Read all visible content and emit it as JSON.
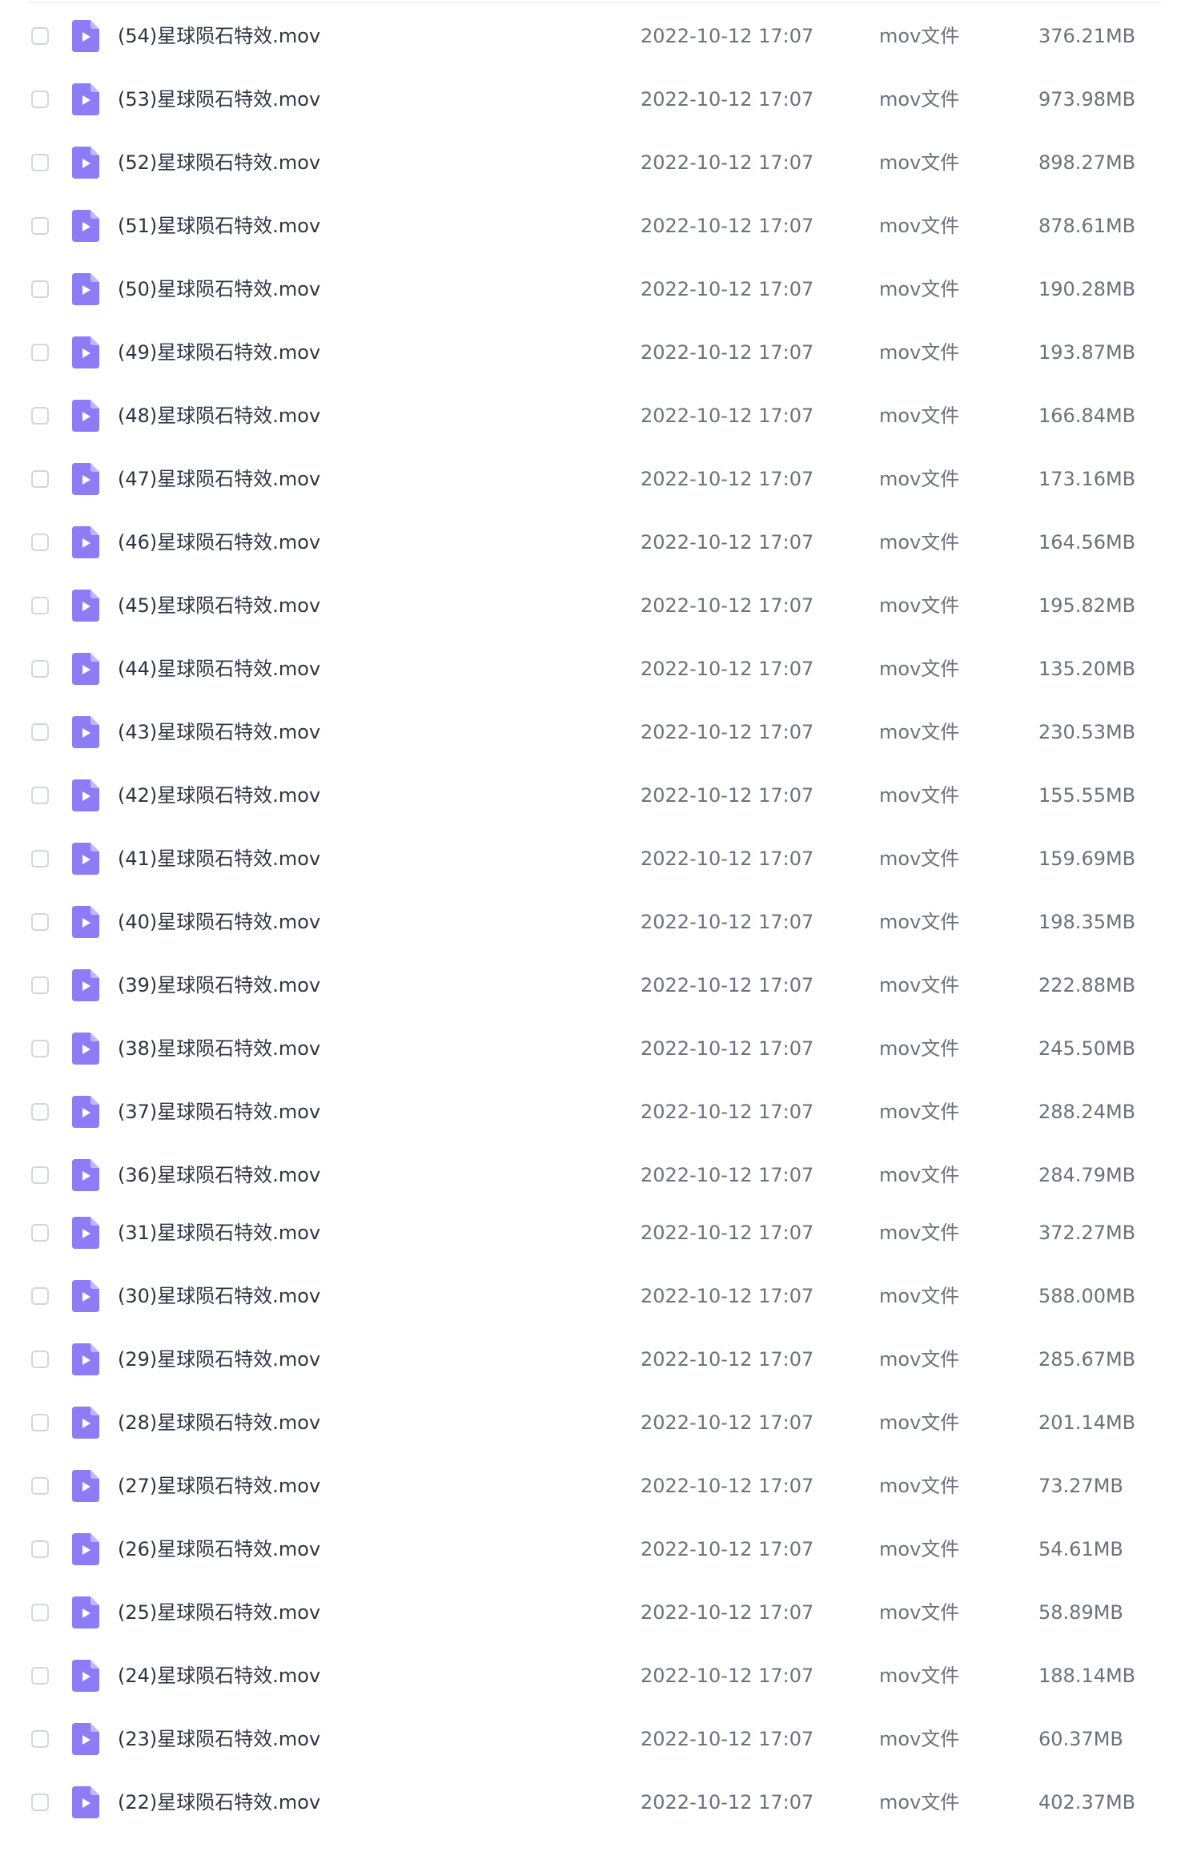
{
  "file_icon_color": "#8c7cf6",
  "files": [
    {
      "name": "(54)星球陨石特效.mov",
      "date": "2022-10-12 17:07",
      "type": "mov文件",
      "size": "376.21MB"
    },
    {
      "name": "(53)星球陨石特效.mov",
      "date": "2022-10-12 17:07",
      "type": "mov文件",
      "size": "973.98MB"
    },
    {
      "name": "(52)星球陨石特效.mov",
      "date": "2022-10-12 17:07",
      "type": "mov文件",
      "size": "898.27MB"
    },
    {
      "name": "(51)星球陨石特效.mov",
      "date": "2022-10-12 17:07",
      "type": "mov文件",
      "size": "878.61MB"
    },
    {
      "name": "(50)星球陨石特效.mov",
      "date": "2022-10-12 17:07",
      "type": "mov文件",
      "size": "190.28MB"
    },
    {
      "name": "(49)星球陨石特效.mov",
      "date": "2022-10-12 17:07",
      "type": "mov文件",
      "size": "193.87MB"
    },
    {
      "name": "(48)星球陨石特效.mov",
      "date": "2022-10-12 17:07",
      "type": "mov文件",
      "size": "166.84MB"
    },
    {
      "name": "(47)星球陨石特效.mov",
      "date": "2022-10-12 17:07",
      "type": "mov文件",
      "size": "173.16MB"
    },
    {
      "name": "(46)星球陨石特效.mov",
      "date": "2022-10-12 17:07",
      "type": "mov文件",
      "size": "164.56MB"
    },
    {
      "name": "(45)星球陨石特效.mov",
      "date": "2022-10-12 17:07",
      "type": "mov文件",
      "size": "195.82MB"
    },
    {
      "name": "(44)星球陨石特效.mov",
      "date": "2022-10-12 17:07",
      "type": "mov文件",
      "size": "135.20MB"
    },
    {
      "name": "(43)星球陨石特效.mov",
      "date": "2022-10-12 17:07",
      "type": "mov文件",
      "size": "230.53MB"
    },
    {
      "name": "(42)星球陨石特效.mov",
      "date": "2022-10-12 17:07",
      "type": "mov文件",
      "size": "155.55MB"
    },
    {
      "name": "(41)星球陨石特效.mov",
      "date": "2022-10-12 17:07",
      "type": "mov文件",
      "size": "159.69MB"
    },
    {
      "name": "(40)星球陨石特效.mov",
      "date": "2022-10-12 17:07",
      "type": "mov文件",
      "size": "198.35MB"
    },
    {
      "name": "(39)星球陨石特效.mov",
      "date": "2022-10-12 17:07",
      "type": "mov文件",
      "size": "222.88MB"
    },
    {
      "name": "(38)星球陨石特效.mov",
      "date": "2022-10-12 17:07",
      "type": "mov文件",
      "size": "245.50MB"
    },
    {
      "name": "(37)星球陨石特效.mov",
      "date": "2022-10-12 17:07",
      "type": "mov文件",
      "size": "288.24MB"
    },
    {
      "name": "(36)星球陨石特效.mov",
      "date": "2022-10-12 17:07",
      "type": "mov文件",
      "size": "284.79MB"
    },
    {
      "name": "(31)星球陨石特效.mov",
      "date": "2022-10-12 17:07",
      "type": "mov文件",
      "size": "372.27MB"
    },
    {
      "name": "(30)星球陨石特效.mov",
      "date": "2022-10-12 17:07",
      "type": "mov文件",
      "size": "588.00MB"
    },
    {
      "name": "(29)星球陨石特效.mov",
      "date": "2022-10-12 17:07",
      "type": "mov文件",
      "size": "285.67MB"
    },
    {
      "name": "(28)星球陨石特效.mov",
      "date": "2022-10-12 17:07",
      "type": "mov文件",
      "size": "201.14MB"
    },
    {
      "name": "(27)星球陨石特效.mov",
      "date": "2022-10-12 17:07",
      "type": "mov文件",
      "size": "73.27MB"
    },
    {
      "name": "(26)星球陨石特效.mov",
      "date": "2022-10-12 17:07",
      "type": "mov文件",
      "size": "54.61MB"
    },
    {
      "name": "(25)星球陨石特效.mov",
      "date": "2022-10-12 17:07",
      "type": "mov文件",
      "size": "58.89MB"
    },
    {
      "name": "(24)星球陨石特效.mov",
      "date": "2022-10-12 17:07",
      "type": "mov文件",
      "size": "188.14MB"
    },
    {
      "name": "(23)星球陨石特效.mov",
      "date": "2022-10-12 17:07",
      "type": "mov文件",
      "size": "60.37MB"
    },
    {
      "name": "(22)星球陨石特效.mov",
      "date": "2022-10-12 17:07",
      "type": "mov文件",
      "size": "402.37MB"
    }
  ]
}
